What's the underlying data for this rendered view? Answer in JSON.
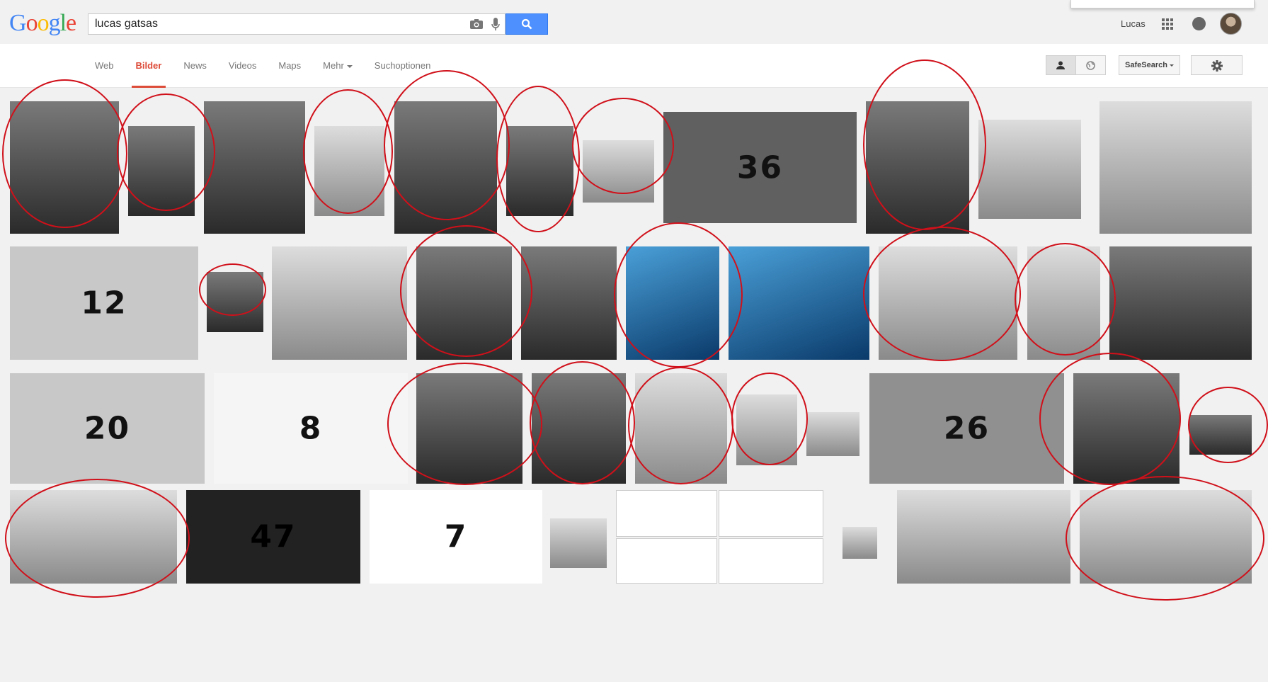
{
  "header": {
    "logo_letters": [
      "G",
      "o",
      "o",
      "g",
      "l",
      "e"
    ],
    "logo_colors": [
      "#4285f4",
      "#ea4335",
      "#fbbc05",
      "#4285f4",
      "#34a853",
      "#ea4335"
    ],
    "search_value": "lucas gatsas",
    "user_name": "Lucas"
  },
  "nav": {
    "tabs": [
      {
        "label": "Web"
      },
      {
        "label": "Bilder",
        "active": true
      },
      {
        "label": "News"
      },
      {
        "label": "Videos"
      },
      {
        "label": "Maps"
      },
      {
        "label": "Mehr",
        "dropdown": true
      },
      {
        "label": "Suchoptionen"
      }
    ],
    "safesearch_label": "SafeSearch",
    "accent_color": "#dd4b39"
  },
  "results": {
    "count_tiles": [
      {
        "label": "36"
      },
      {
        "label": "12"
      },
      {
        "label": "20"
      },
      {
        "label": "8"
      },
      {
        "label": "26"
      },
      {
        "label": "47"
      },
      {
        "label": "7"
      }
    ],
    "highlight_color": "#d0101a"
  }
}
